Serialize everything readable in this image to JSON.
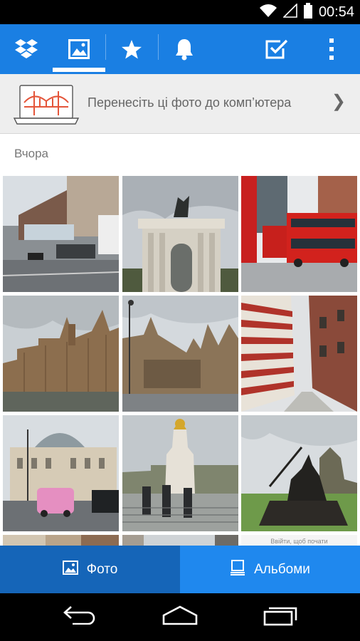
{
  "status_bar": {
    "time": "00:54"
  },
  "toolbar": {
    "tabs": [
      {
        "name": "dropbox-icon"
      },
      {
        "name": "photos-tab-icon",
        "active": true
      },
      {
        "name": "favorites-star-icon"
      },
      {
        "name": "notifications-bell-icon"
      }
    ],
    "select_icon": "checkbox-select-icon",
    "overflow_icon": "more-vert-icon"
  },
  "promo": {
    "text": "Перенесіть ці фото до комп’ютера",
    "chevron": "❯"
  },
  "section": {
    "label": "Вчора"
  },
  "bottom_tabs": {
    "photos_label": "Фото",
    "albums_label": "Альбоми"
  },
  "partial_photo_caption": "Ввійти, щоб почати",
  "colors": {
    "toolbar": "#1a7fe3",
    "photos_tab": "#1565b8",
    "albums_tab": "#1f88ee"
  }
}
